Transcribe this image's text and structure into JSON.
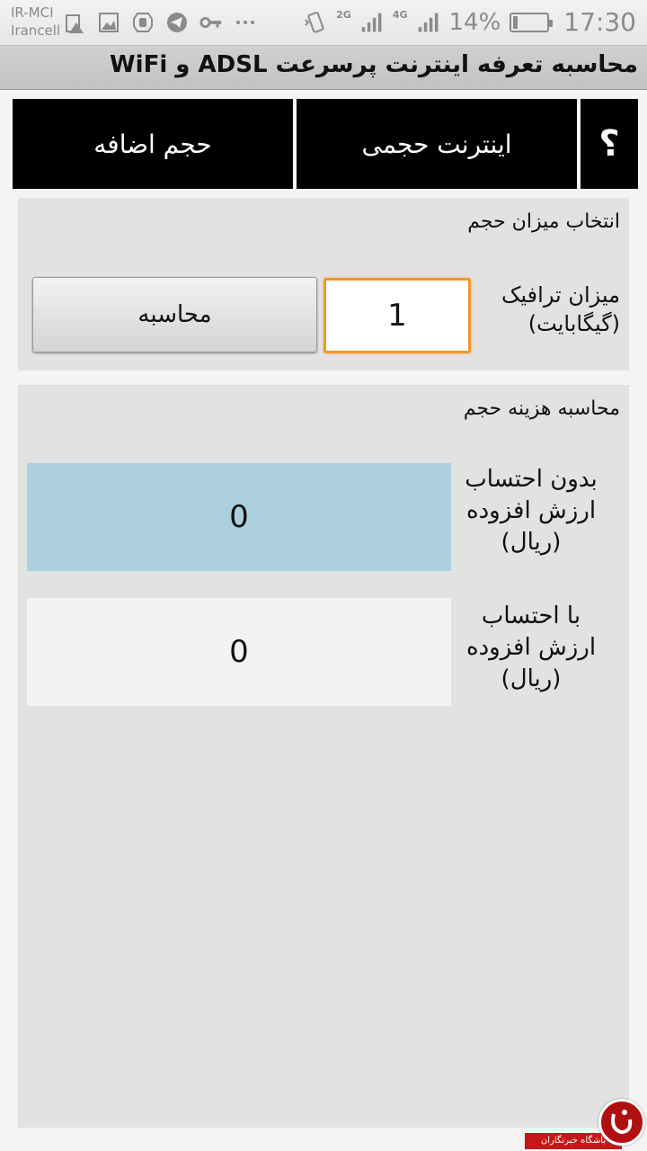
{
  "status_bar": {
    "carrier_line1": "IR-MCI",
    "carrier_line2": "Irancell",
    "net_2g": "2G",
    "net_4g": "4G",
    "battery_percent": "14%",
    "battery_level": 0.14,
    "time": "17:30",
    "icons": [
      "warning-icon",
      "image-icon",
      "hand-icon",
      "telegram-icon",
      "key-icon",
      "more-icon",
      "vibrate-icon",
      "signal-icon",
      "signal-icon",
      "battery-icon"
    ]
  },
  "app": {
    "title": "محاسبه تعرفه اینترنت پرسرعت ADSL و WiFi"
  },
  "tabs": {
    "help": "؟",
    "volume_internet": "اینترنت حجمی",
    "extra_volume": "حجم اضافه"
  },
  "volume_section": {
    "title": "انتخاب میزان حجم",
    "traffic_label_line1": "میزان ترافیک",
    "traffic_label_line2": "(گیگابایت)",
    "traffic_value": "1",
    "calc_button": "محاسبه"
  },
  "cost_section": {
    "title": "محاسبه هزینه حجم",
    "without_vat_line1": "بدون احتساب",
    "without_vat_line2": "ارزش افزوده",
    "without_vat_line3": "(ریال)",
    "without_vat_value": "0",
    "with_vat_line1": "با احتساب",
    "with_vat_line2": "ارزش افزوده",
    "with_vat_line3": "(ریال)",
    "with_vat_value": "0"
  },
  "watermark": {
    "text": "باشگاه خبرنگاران"
  },
  "colors": {
    "accent_orange": "#f0982c",
    "result_blue": "#abcfdc",
    "tab_black": "#000000",
    "watermark_red": "#c41818"
  }
}
